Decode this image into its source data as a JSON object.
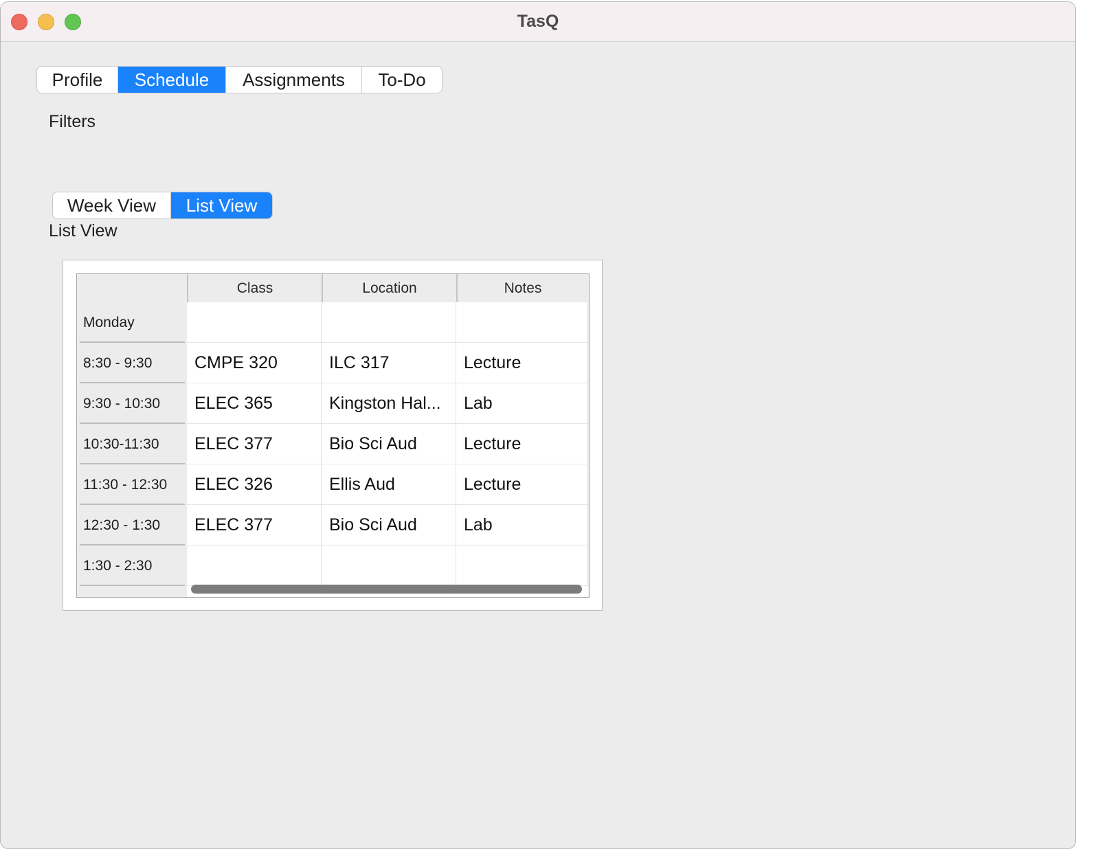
{
  "window": {
    "title": "TasQ"
  },
  "tabs": [
    {
      "label": "Profile",
      "active": false
    },
    {
      "label": "Schedule",
      "active": true
    },
    {
      "label": "Assignments",
      "active": false
    },
    {
      "label": "To-Do",
      "active": false
    }
  ],
  "filters_label": "Filters",
  "view_toggle": [
    {
      "label": "Week View",
      "active": false
    },
    {
      "label": "List View",
      "active": true
    }
  ],
  "view_heading": "List View",
  "table": {
    "columns": [
      "Class",
      "Location",
      "Notes"
    ],
    "rows": [
      {
        "header": "Monday",
        "cells": [
          "",
          "",
          ""
        ]
      },
      {
        "header": "8:30 - 9:30",
        "cells": [
          "CMPE 320",
          "ILC 317",
          "Lecture"
        ]
      },
      {
        "header": "9:30 - 10:30",
        "cells": [
          "ELEC 365",
          "Kingston Hal...",
          "Lab"
        ]
      },
      {
        "header": "10:30-11:30",
        "cells": [
          "ELEC 377",
          "Bio Sci Aud",
          "Lecture"
        ]
      },
      {
        "header": "11:30 - 12:30",
        "cells": [
          "ELEC 326",
          "Ellis Aud",
          "Lecture"
        ]
      },
      {
        "header": "12:30 - 1:30",
        "cells": [
          "ELEC 377",
          "Bio Sci Aud",
          "Lab"
        ]
      },
      {
        "header": "1:30 - 2:30",
        "cells": [
          "",
          "",
          ""
        ]
      }
    ]
  },
  "colors": {
    "accent": "#1a82fb",
    "window_bg": "#ececec",
    "titlebar_bg": "#f6eff1",
    "close": "#ed6a5e",
    "minimize": "#f5bf4f",
    "zoom": "#61c554"
  }
}
